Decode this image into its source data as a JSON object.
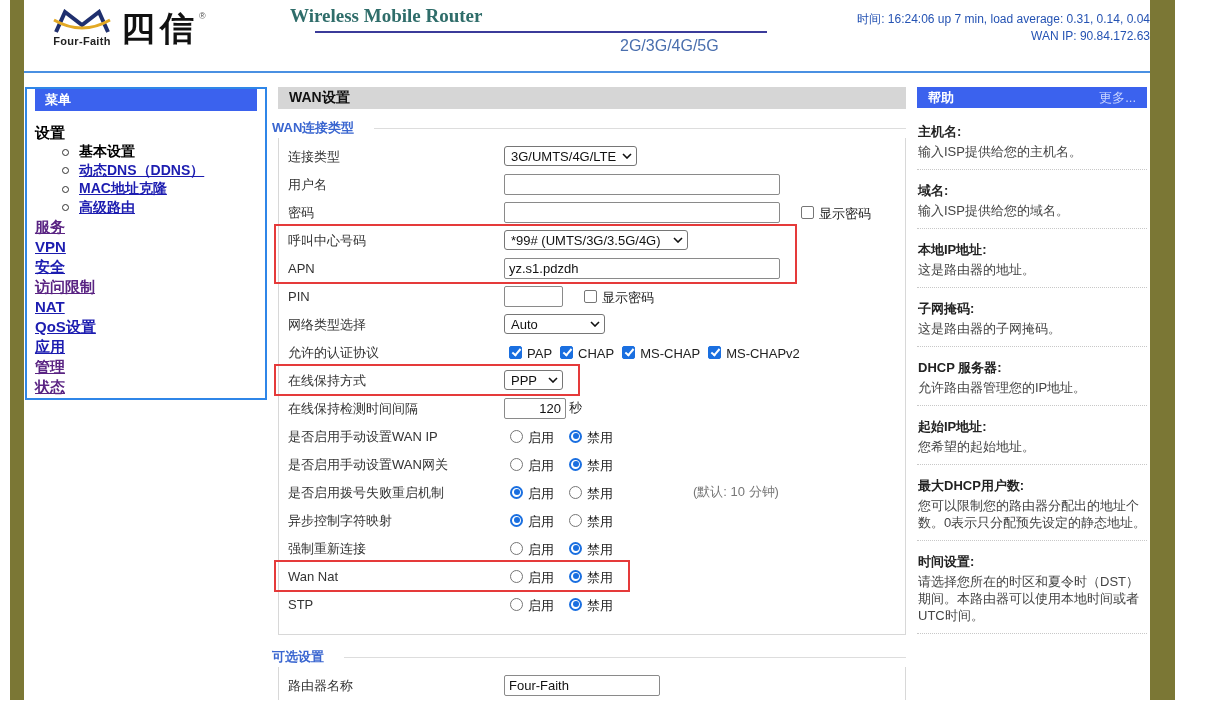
{
  "header": {
    "logo": {
      "brand": "Four-Faith",
      "mark": "四信",
      "registered": "®"
    },
    "title": "Wireless Mobile Router",
    "subtitle": "2G/3G/4G/5G",
    "status_lines": [
      "时间: 16:24:06 up 7 min, load average: 0.31, 0.14, 0.04",
      "WAN IP: 90.84.172.63"
    ]
  },
  "menu": {
    "title": "菜单",
    "items": [
      {
        "kind": "heading",
        "label": "设置",
        "children": [
          {
            "label": "基本设置",
            "selected": true
          },
          {
            "label": "动态DNS（DDNS）",
            "selected": false
          },
          {
            "label": "MAC地址克隆",
            "selected": false
          },
          {
            "label": "高级路由",
            "selected": false
          }
        ]
      },
      {
        "kind": "link",
        "label": "服务",
        "visited": true
      },
      {
        "kind": "link",
        "label": "VPN",
        "visited": false
      },
      {
        "kind": "link",
        "label": "安全",
        "visited": false
      },
      {
        "kind": "link",
        "label": "访问限制",
        "visited": true
      },
      {
        "kind": "link",
        "label": "NAT",
        "visited": false
      },
      {
        "kind": "link",
        "label": "QoS设置",
        "visited": false
      },
      {
        "kind": "link",
        "label": "应用",
        "visited": false
      },
      {
        "kind": "link",
        "label": "管理",
        "visited": true
      },
      {
        "kind": "link",
        "label": "状态",
        "visited": true
      }
    ]
  },
  "main": {
    "title": "WAN设置",
    "sections": [
      {
        "legend": "WAN连接类型",
        "rows": [
          {
            "label": "连接类型",
            "highlighted": false,
            "controls": [
              {
                "kind": "select",
                "value": "3G/UMTS/4G/LTE"
              }
            ]
          },
          {
            "label": "用户名",
            "highlighted": false,
            "controls": [
              {
                "kind": "input"
              }
            ]
          },
          {
            "label": "密码",
            "highlighted": false,
            "controls": [
              {
                "kind": "input"
              },
              {
                "kind": "checkbox",
                "label": "显示密码",
                "checked": false
              }
            ]
          },
          {
            "label": "呼叫中心号码",
            "highlighted": true,
            "controls": [
              {
                "kind": "select",
                "value": "*99# (UMTS/3G/3.5G/4G)"
              }
            ]
          },
          {
            "label": "APN",
            "highlighted": true,
            "controls": [
              {
                "kind": "input",
                "value": "yz.s1.pdzdh"
              }
            ]
          },
          {
            "label": "PIN",
            "highlighted": false,
            "controls": [
              {
                "kind": "input"
              },
              {
                "kind": "checkbox",
                "label": "显示密码",
                "checked": false
              }
            ]
          },
          {
            "label": "网络类型选择",
            "highlighted": false,
            "controls": [
              {
                "kind": "select",
                "value": "Auto"
              }
            ]
          },
          {
            "label": "允许的认证协议",
            "highlighted": false,
            "controls": [
              {
                "kind": "checkbox",
                "label": "PAP",
                "checked": true
              },
              {
                "kind": "checkbox",
                "label": "CHAP",
                "checked": true
              },
              {
                "kind": "checkbox",
                "label": "MS-CHAP",
                "checked": true
              },
              {
                "kind": "checkbox",
                "label": "MS-CHAPv2",
                "checked": true
              }
            ]
          },
          {
            "label": "在线保持方式",
            "highlighted": true,
            "controls": [
              {
                "kind": "select",
                "value": "PPP"
              }
            ]
          },
          {
            "label": "在线保持检测时间间隔",
            "highlighted": false,
            "controls": [
              {
                "kind": "number",
                "value": "120"
              },
              {
                "kind": "unit",
                "text": "秒"
              }
            ]
          },
          {
            "label": "是否启用手动设置WAN IP",
            "highlighted": false,
            "controls": [
              {
                "kind": "radio",
                "label": "启用",
                "selected": false
              },
              {
                "kind": "radio",
                "label": "禁用",
                "selected": true
              }
            ]
          },
          {
            "label": "是否启用手动设置WAN网关",
            "highlighted": false,
            "controls": [
              {
                "kind": "radio",
                "label": "启用",
                "selected": false
              },
              {
                "kind": "radio",
                "label": "禁用",
                "selected": true
              }
            ]
          },
          {
            "label": "是否启用拨号失败重启机制",
            "highlighted": false,
            "controls": [
              {
                "kind": "radio",
                "label": "启用",
                "selected": true
              },
              {
                "kind": "radio",
                "label": "禁用",
                "selected": false
              },
              {
                "kind": "note",
                "text": "(默认: 10 分钟)"
              }
            ]
          },
          {
            "label": "异步控制字符映射",
            "highlighted": false,
            "controls": [
              {
                "kind": "radio",
                "label": "启用",
                "selected": true
              },
              {
                "kind": "radio",
                "label": "禁用",
                "selected": false
              }
            ]
          },
          {
            "label": "强制重新连接",
            "highlighted": false,
            "controls": [
              {
                "kind": "radio",
                "label": "启用",
                "selected": false
              },
              {
                "kind": "radio",
                "label": "禁用",
                "selected": true
              }
            ]
          },
          {
            "label": "Wan Nat",
            "highlighted": true,
            "controls": [
              {
                "kind": "radio",
                "label": "启用",
                "selected": false
              },
              {
                "kind": "radio",
                "label": "禁用",
                "selected": true
              }
            ]
          },
          {
            "label": "STP",
            "highlighted": false,
            "controls": [
              {
                "kind": "radio",
                "label": "启用",
                "selected": false
              },
              {
                "kind": "radio",
                "label": "禁用",
                "selected": true
              }
            ]
          }
        ]
      },
      {
        "legend": "可选设置",
        "rows": [
          {
            "label": "路由器名称",
            "highlighted": false,
            "controls": [
              {
                "kind": "input",
                "value": "Four-Faith"
              }
            ]
          }
        ]
      }
    ]
  },
  "help": {
    "title": "帮助",
    "more": "更多...",
    "entries": [
      {
        "title": "主机名:",
        "text": "输入ISP提供给您的主机名。"
      },
      {
        "title": "域名:",
        "text": "输入ISP提供给您的域名。"
      },
      {
        "title": "本地IP地址:",
        "text": "这是路由器的地址。"
      },
      {
        "title": "子网掩码:",
        "text": "这是路由器的子网掩码。"
      },
      {
        "title": "DHCP 服务器:",
        "text": "允许路由器管理您的IP地址。"
      },
      {
        "title": "起始IP地址:",
        "text": "您希望的起始地址。"
      },
      {
        "title": "最大DHCP用户数:",
        "text": "您可以限制您的路由器分配出的地址个数。0表示只分配预先设定的静态地址。"
      },
      {
        "title": "时间设置:",
        "text": "请选择您所在的时区和夏令时（DST）期间。本路由器可以使用本地时间或者UTC时间。"
      }
    ]
  }
}
